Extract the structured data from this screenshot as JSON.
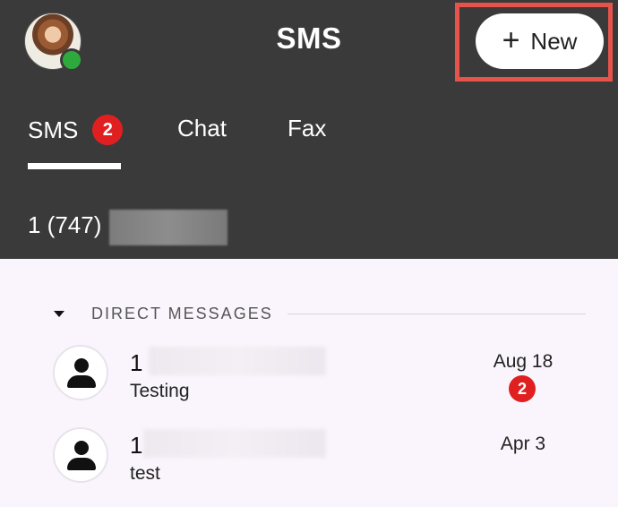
{
  "header": {
    "title": "SMS",
    "avatar_icon": "user-photo-avatar",
    "status": "online",
    "status_color": "#2eaa3c",
    "new_button": {
      "icon": "plus-icon",
      "plus": "+",
      "label": "New"
    }
  },
  "tabs": [
    {
      "label": "SMS",
      "badge": "2",
      "active": true
    },
    {
      "label": "Chat"
    },
    {
      "label": "Fax"
    }
  ],
  "phone_number": "1 (747)",
  "section": {
    "title": "DIRECT MESSAGES",
    "expanded": true
  },
  "messages": [
    {
      "name": "1",
      "preview": "Testing",
      "date": "Aug 18",
      "badge": "2"
    },
    {
      "name": "1",
      "preview": "test",
      "date": "Apr 3"
    }
  ],
  "colors": {
    "header_bg": "#3a3a3a",
    "badge": "#e02020",
    "highlight": "#e5534b",
    "list_bg": "#faf5fc"
  }
}
